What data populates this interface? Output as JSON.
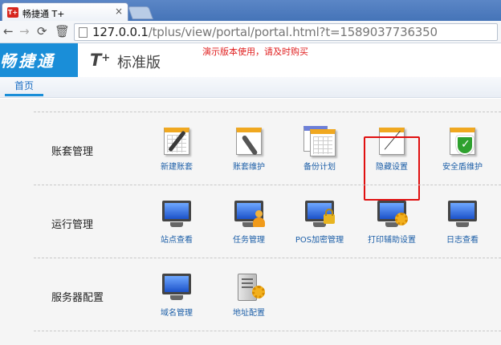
{
  "browser": {
    "tab_favicon": "T+",
    "tab_title": "畅捷通 T+",
    "tab_close": "×",
    "url_host": "127.0.0.1",
    "url_path": "/tplus/view/portal/portal.html?t=1589037736350"
  },
  "header": {
    "logo": "畅捷通",
    "product_mark": "T",
    "product_mark_sup": "+",
    "product_name": "标准版",
    "demo_notice": "演示版本使用，请及时购买"
  },
  "nav": {
    "home_tab": "首页"
  },
  "sections": [
    {
      "title": "账套管理",
      "items": [
        {
          "label": "新建账套",
          "icon": "new-account-book-icon"
        },
        {
          "label": "账套维护",
          "icon": "account-maintain-icon"
        },
        {
          "label": "备份计划",
          "icon": "backup-plan-icon"
        },
        {
          "label": "隐藏设置",
          "icon": "hidden-settings-icon"
        },
        {
          "label": "安全盾维护",
          "icon": "security-shield-icon"
        }
      ]
    },
    {
      "title": "运行管理",
      "items": [
        {
          "label": "站点查看",
          "icon": "site-view-icon"
        },
        {
          "label": "任务管理",
          "icon": "task-manage-icon"
        },
        {
          "label": "POS加密管理",
          "icon": "pos-encrypt-icon"
        },
        {
          "label": "打印辅助设置",
          "icon": "print-assist-icon"
        },
        {
          "label": "日志查看",
          "icon": "log-view-icon"
        }
      ]
    },
    {
      "title": "服务器配置",
      "items": [
        {
          "label": "域名管理",
          "icon": "domain-manage-icon"
        },
        {
          "label": "地址配置",
          "icon": "address-config-icon"
        }
      ]
    }
  ],
  "colors": {
    "accent": "#1a8ed8",
    "highlight": "#e01010",
    "link": "#1d5fa8"
  }
}
